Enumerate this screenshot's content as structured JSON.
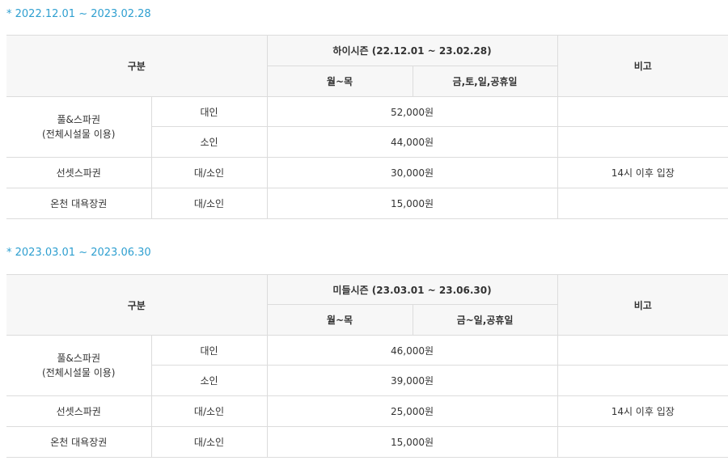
{
  "sections": [
    {
      "period": "* 2022.12.01 ~ 2023.02.28",
      "header": {
        "category": "구분",
        "season": "하이시즌 (22.12.01 ~ 23.02.28)",
        "weekday": "월~목",
        "weekend": "금,토,일,공휴일",
        "note": "비고"
      },
      "rows": {
        "fullspa": {
          "title": "풀&스파권",
          "subtitle": "(전체시설물 이용)"
        },
        "adult": {
          "type": "대인",
          "price": "52,000원"
        },
        "child": {
          "type": "소인",
          "price": "44,000원"
        },
        "sunset": {
          "title": "선셋스파권",
          "type": "대/소인",
          "price": "30,000원",
          "note": "14시 이후 입장"
        },
        "bath": {
          "title": "온천 대욕장권",
          "type": "대/소인",
          "price": "15,000원"
        }
      }
    },
    {
      "period": "* 2023.03.01 ~ 2023.06.30",
      "header": {
        "category": "구분",
        "season": "미들시즌 (23.03.01 ~ 23.06.30)",
        "weekday": "월~목",
        "weekend": "금~일,공휴일",
        "note": "비고"
      },
      "rows": {
        "fullspa": {
          "title": "풀&스파권",
          "subtitle": "(전체시설물 이용)"
        },
        "adult": {
          "type": "대인",
          "price": "46,000원"
        },
        "child": {
          "type": "소인",
          "price": "39,000원"
        },
        "sunset": {
          "title": "선셋스파권",
          "type": "대/소인",
          "price": "25,000원",
          "note": "14시 이후 입장"
        },
        "bath": {
          "title": "온천 대욕장권",
          "type": "대/소인",
          "price": "15,000원"
        }
      }
    }
  ]
}
